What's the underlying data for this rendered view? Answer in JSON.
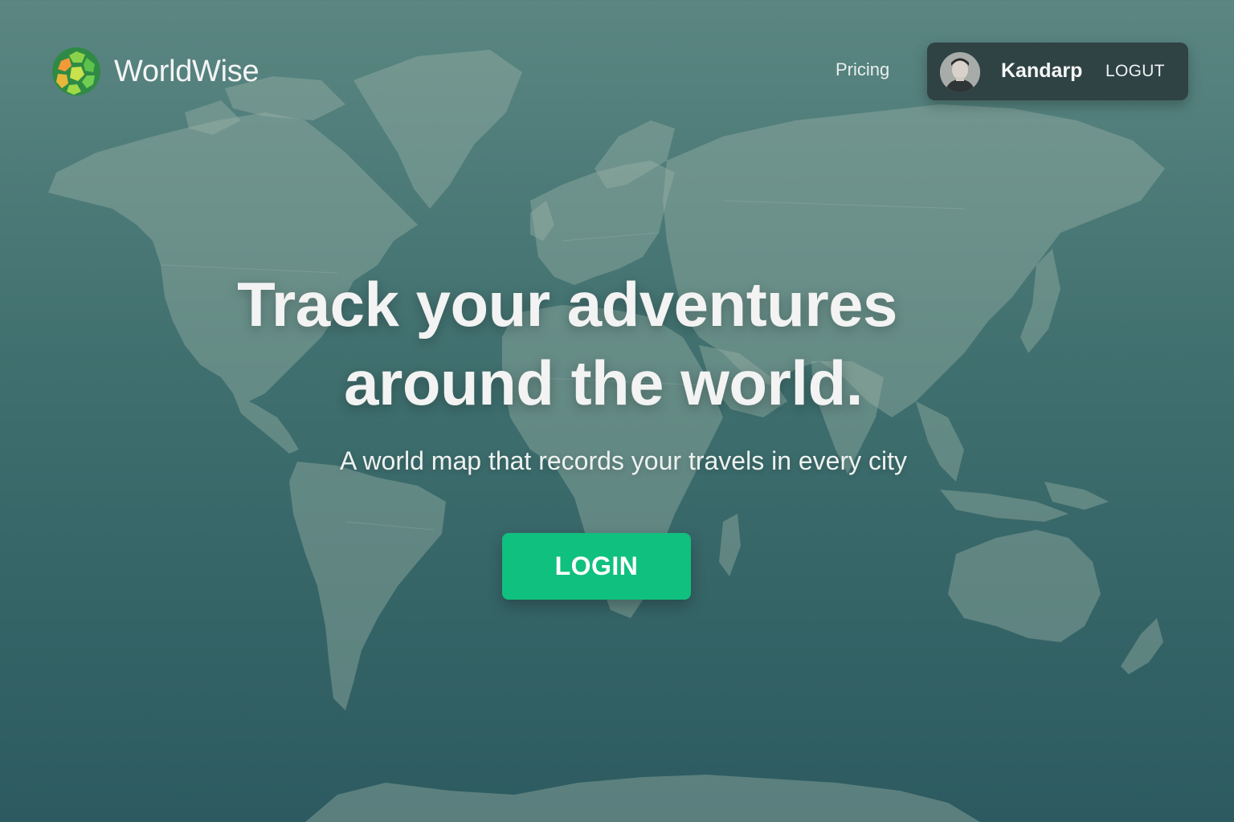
{
  "brand": {
    "name": "WorldWise",
    "logo_icon": "globe-logo-icon"
  },
  "nav": {
    "pricing_label": "Pricing"
  },
  "user": {
    "name": "Kandarp",
    "logout_label": "LOGUT",
    "avatar_icon": "user-avatar"
  },
  "hero": {
    "headline_line1": "Track your adventures",
    "headline_line2": "around the world.",
    "subtitle": "A world map that records your travels in every city",
    "cta_label": "LOGIN"
  },
  "background": {
    "image": "world-map",
    "map_color": "#9bb3a6"
  },
  "colors": {
    "accent": "#10c07e",
    "user_box": "#2f4244",
    "text": "#f2f3f2"
  }
}
